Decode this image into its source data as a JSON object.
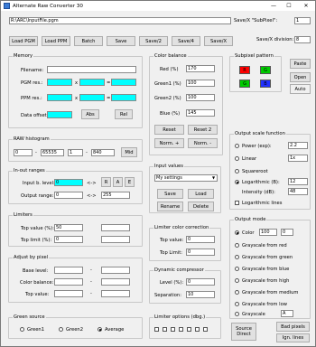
{
  "title": "Alternate Raw Converter 30",
  "controls": {
    "minimize": "—",
    "maximize": "☐",
    "close": "✕"
  },
  "file_path": "R:\\ARC\\InputFile.pgm",
  "save_suffix_label": "Save/X \"SubPixel\":",
  "save_suffix_value": "1",
  "save_division_label": "Save/X division:",
  "save_division_value": "8",
  "toolbar": [
    "Load PGM",
    "Load PPM",
    "Batch",
    "Save",
    "Save/2",
    "Save/4",
    "Save/X"
  ],
  "memory": {
    "title": "Memory",
    "filename_label": "Filename:",
    "pgm_label": "PGM res.:",
    "ppm_label": "PPM res.:",
    "offset_label": "Data offset:",
    "x1": "x",
    "eq1": "=",
    "x2": "x",
    "eq2": "=",
    "abs": "Abs",
    "rel": "Rel"
  },
  "color_balance": {
    "title": "Color balance",
    "red_label": "Red (%)",
    "red": "170",
    "green1_label": "Green1 (%)",
    "green1": "100",
    "green2_label": "Green2 (%)",
    "green2": "100",
    "blue_label": "Blue (%)",
    "blue": "145",
    "reset": "Reset",
    "reset2": "Reset 2",
    "norm_plus": "Norm. +",
    "norm_minus": "Norm. -"
  },
  "subpixel": {
    "title": "Subpixel pattern",
    "r": "R",
    "g1": "G",
    "g2": "G",
    "b": "B"
  },
  "paste": "Paste",
  "open": "Open",
  "auto": "Auto",
  "histogram": {
    "title": "RAW histogram",
    "min": "0",
    "max": "65535",
    "v1": "1",
    "v2": "840",
    "mid": "Mid"
  },
  "inout": {
    "title": "In-out ranges",
    "input_label": "Input b. level:",
    "input_val": "0",
    "output_label": "Output range:",
    "out_min": "0",
    "out_max": "255",
    "arrow1": "<->",
    "arrow2": "<->",
    "r": "R",
    "a": "A",
    "e": "E"
  },
  "input_values": {
    "title": "Input values",
    "selected": "My settings",
    "save": "Save",
    "load": "Load",
    "rename": "Rename",
    "delete": "Delete"
  },
  "scale": {
    "title": "Output scale function",
    "power": "Power (exp):",
    "power_val": "2.2",
    "linear": "Linear",
    "linear_val": "1x",
    "sqrt": "Squareroot",
    "log": "Logarithmic (B):",
    "log_val": "12",
    "intensity": "Intensity (dB):",
    "intensity_val": "48",
    "loglines": "Logarithmic lines"
  },
  "limiters": {
    "title": "Limiters",
    "top_label": "Top value (%):",
    "top": "50",
    "bottom_label": "Top limit (%):",
    "bottom": "0"
  },
  "limiter_cc": {
    "title": "Limiter color correction",
    "top_label": "Top value:",
    "top": "0",
    "limit_label": "Top Limit:",
    "limit": "0"
  },
  "output_mode": {
    "title": "Output mode",
    "color": "Color",
    "color_val": "100",
    "color_val2": "0",
    "items": [
      "Grayscale from red",
      "Grayscale from green",
      "Grayscale from blue",
      "Grayscale from high",
      "Grayscale from medium",
      "Grayscale from low",
      "Grayscale"
    ],
    "gray_val": "A"
  },
  "adjust": {
    "title": "Adjust by pixel",
    "base": "Base level:",
    "colbal": "Color balance:",
    "top": "Top value:"
  },
  "dyn": {
    "title": "Dynamic compressor",
    "level_label": "Level (%):",
    "level": "0",
    "sep_label": "Separation:",
    "sep": "10"
  },
  "green_source": {
    "title": "Green source",
    "opts": [
      "Green1",
      "Green2",
      "Average"
    ]
  },
  "limiter_opts": {
    "title": "Limiter options (dbg.)"
  },
  "source_direct": "Source Direct",
  "bad_pixels": "Bad pixels",
  "ign_lines": "Ign. lines",
  "accent": "#00ffff"
}
